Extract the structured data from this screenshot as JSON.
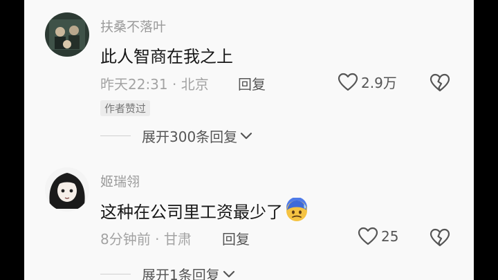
{
  "comments": [
    {
      "username": "扶桑不落叶",
      "content": "此人智商在我之上",
      "time": "昨天22:31",
      "separator": "·",
      "location": "北京",
      "reply_label": "回复",
      "like_count": "2.9万",
      "badge": "作者赞过",
      "expand_label": "展开300条回复",
      "avatar_icon": "group-photo-avatar",
      "like_icon": "heart-outline-icon",
      "dislike_icon": "broken-heart-icon"
    },
    {
      "username": "姬瑞翎",
      "content": "这种在公司里工资最少了",
      "emoji_icon": "sweating-face-emoji",
      "time": "8分钟前",
      "separator": "·",
      "location": "甘肃",
      "reply_label": "回复",
      "like_count": "25",
      "expand_label": "展开1条回复",
      "avatar_icon": "anime-girl-avatar",
      "like_icon": "heart-outline-icon",
      "dislike_icon": "broken-heart-icon"
    }
  ],
  "colors": {
    "background": "#f9f9f9",
    "username": "#9a9a9a",
    "content": "#161616",
    "meta": "#a3a3a3",
    "action": "#555555"
  }
}
